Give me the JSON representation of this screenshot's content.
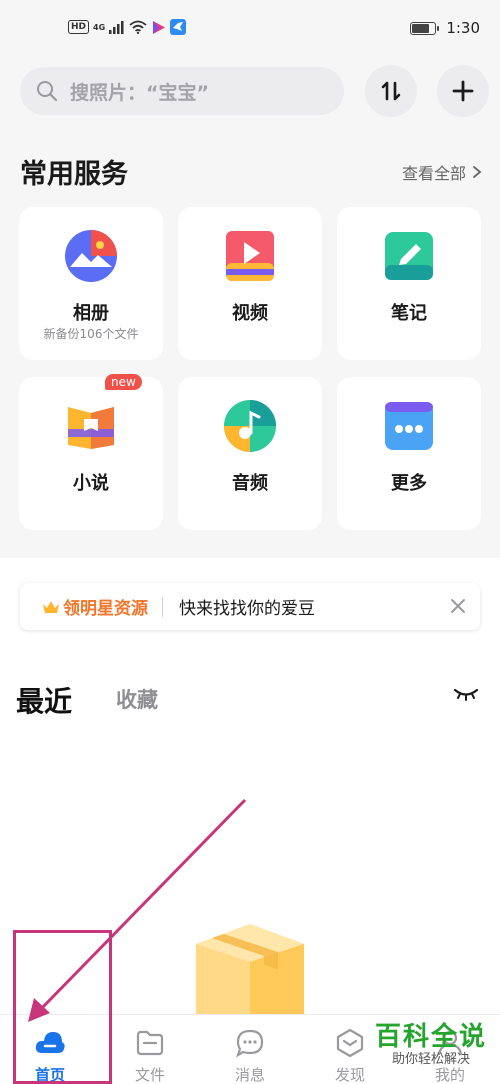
{
  "status_bar": {
    "hd": "HD",
    "network": "4G",
    "time": "1:30",
    "battery_level": 0.75
  },
  "search": {
    "placeholder": "搜照片：“宝宝”"
  },
  "services": {
    "title": "常用服务",
    "view_all": "查看全部",
    "items": [
      {
        "label": "相册",
        "sublabel": "新备份106个文件",
        "icon": "album-icon"
      },
      {
        "label": "视频",
        "icon": "video-icon"
      },
      {
        "label": "笔记",
        "icon": "notes-icon"
      },
      {
        "label": "小说",
        "icon": "novel-icon",
        "badge": "new"
      },
      {
        "label": "音频",
        "icon": "audio-icon"
      },
      {
        "label": "更多",
        "icon": "more-icon"
      }
    ]
  },
  "banner": {
    "brand": "领明星资源",
    "text": "快来找找你的爱豆"
  },
  "tabs": {
    "recent": "最近",
    "favorites": "收藏"
  },
  "bottom_nav": [
    {
      "label": "首页",
      "icon": "home-cloud-icon",
      "active": true
    },
    {
      "label": "文件",
      "icon": "folder-icon"
    },
    {
      "label": "消息",
      "icon": "message-icon"
    },
    {
      "label": "发现",
      "icon": "discover-icon"
    },
    {
      "label": "我的",
      "icon": "profile-icon"
    }
  ],
  "watermark": {
    "main": "百科全说",
    "sub": "助你轻松解决"
  },
  "colors": {
    "accent": "#1a73e8",
    "annotation": "#c7357a",
    "watermark_green": "#26a52e",
    "banner_brand": "#f0772b"
  }
}
